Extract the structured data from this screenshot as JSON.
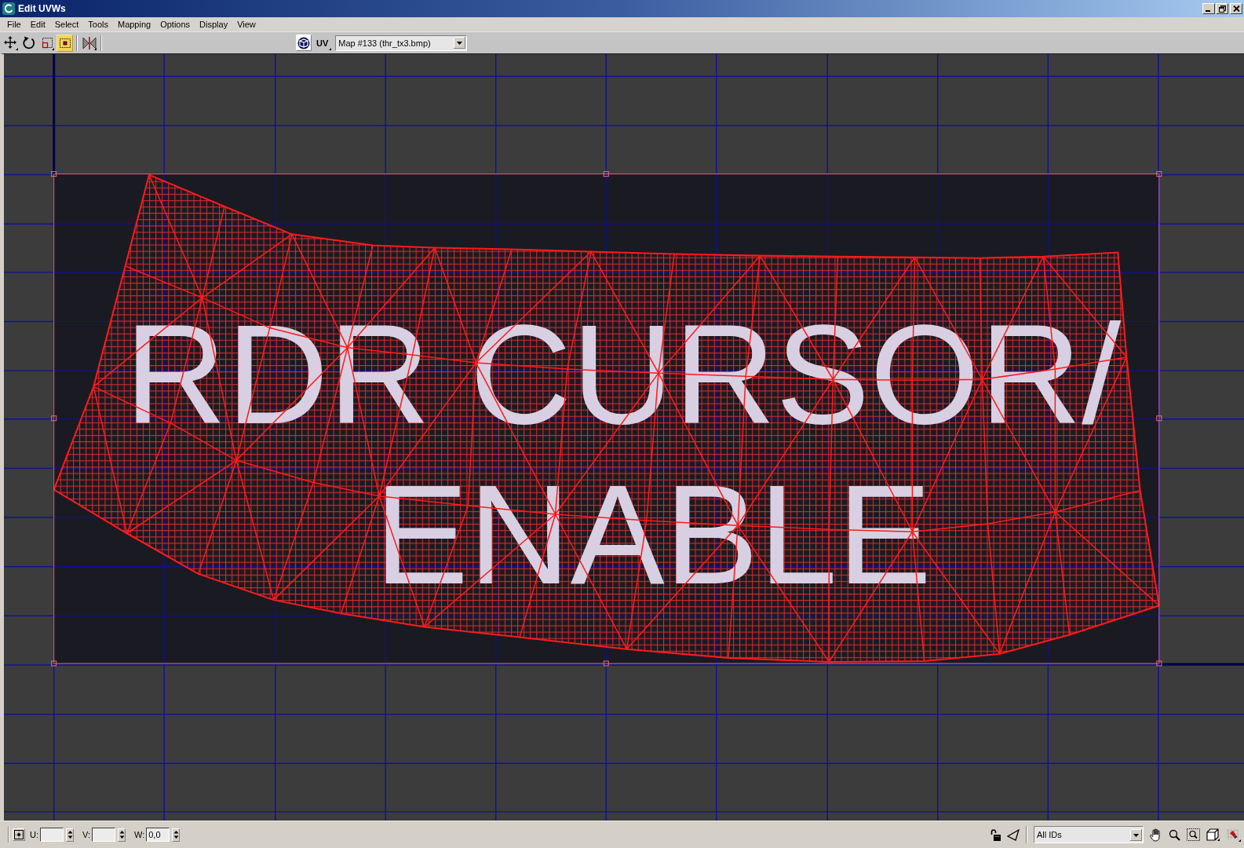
{
  "window": {
    "title": "Edit UVWs"
  },
  "menu": [
    "File",
    "Edit",
    "Select",
    "Tools",
    "Mapping",
    "Options",
    "Display",
    "View"
  ],
  "toolbar": {
    "tools": [
      {
        "kind": "move",
        "selected": false
      },
      {
        "kind": "rotate",
        "selected": false
      },
      {
        "kind": "scale",
        "selected": false
      },
      {
        "kind": "freeform",
        "selected": true
      },
      {
        "kind": "mirror",
        "selected": false
      }
    ],
    "uv_button": "UV",
    "map_dropdown": "Map #133 (thr_tx3.bmp)"
  },
  "viewport": {
    "texture_text": [
      "RDR CURSOR/",
      "ENABLE"
    ]
  },
  "status_bar": {
    "coordinates": [
      {
        "label": "U:"
      },
      {
        "label": "V:"
      },
      {
        "label": "W:",
        "value": "0,0"
      }
    ],
    "id_dropdown": "All IDs"
  }
}
